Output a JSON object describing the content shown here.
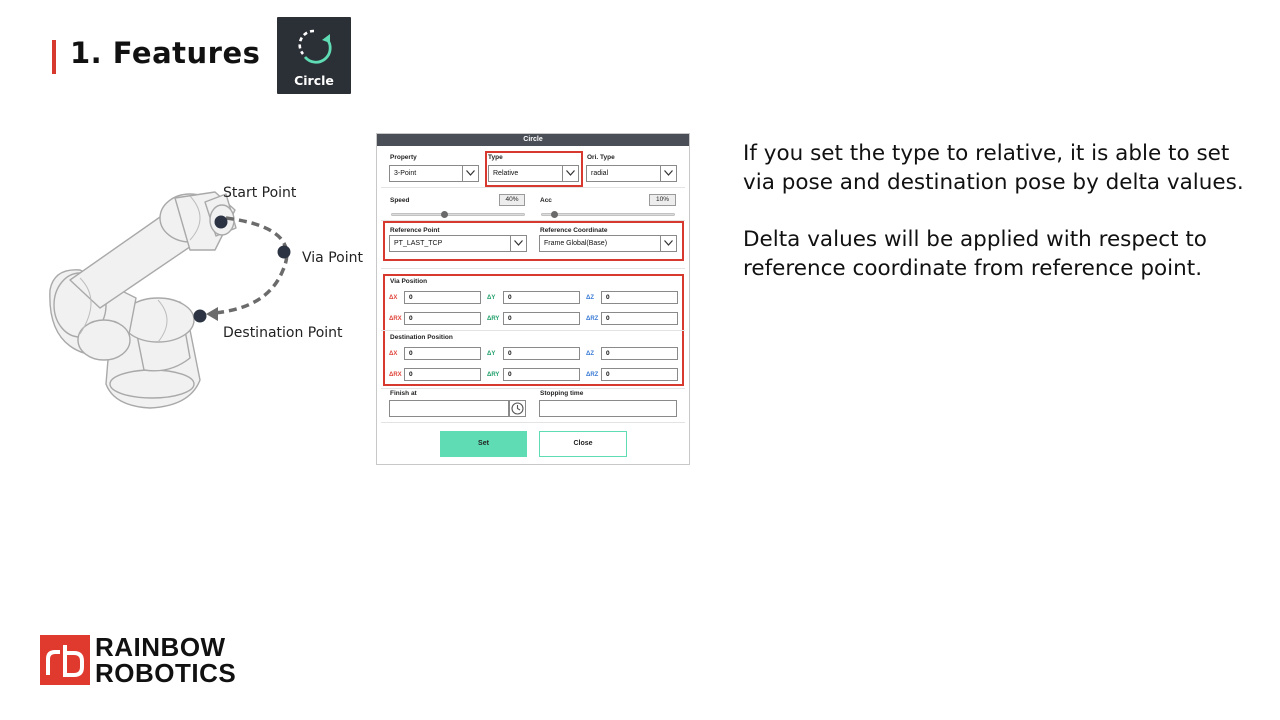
{
  "header": {
    "title": "1. Features",
    "tile_label": "Circle",
    "tile_icon": "circle-arrow-icon"
  },
  "illustration": {
    "labels": {
      "start": "Start Point",
      "via": "Via Point",
      "destination": "Destination Point"
    }
  },
  "dialog": {
    "title": "Circle",
    "property": {
      "label": "Property",
      "value": "3-Point"
    },
    "type": {
      "label": "Type",
      "value": "Relative"
    },
    "ori_type": {
      "label": "Ori. Type",
      "value": "radial"
    },
    "speed": {
      "label": "Speed",
      "value": "40%",
      "level": 0.4
    },
    "acc": {
      "label": "Acc",
      "value": "10%",
      "level": 0.1
    },
    "reference_point": {
      "label": "Reference Point",
      "value": "PT_LAST_TCP"
    },
    "reference_coordinate": {
      "label": "Reference Coordinate",
      "value": "Frame Global(Base)"
    },
    "via_position": {
      "label": "Via Position",
      "fields": [
        {
          "axis": "ΔX",
          "value": "0"
        },
        {
          "axis": "ΔY",
          "value": "0"
        },
        {
          "axis": "ΔZ",
          "value": "0"
        },
        {
          "axis": "ΔRX",
          "value": "0"
        },
        {
          "axis": "ΔRY",
          "value": "0"
        },
        {
          "axis": "ΔRZ",
          "value": "0"
        }
      ]
    },
    "destination_position": {
      "label": "Destination Position",
      "fields": [
        {
          "axis": "ΔX",
          "value": "0"
        },
        {
          "axis": "ΔY",
          "value": "0"
        },
        {
          "axis": "ΔZ",
          "value": "0"
        },
        {
          "axis": "ΔRX",
          "value": "0"
        },
        {
          "axis": "ΔRY",
          "value": "0"
        },
        {
          "axis": "ΔRZ",
          "value": "0"
        }
      ]
    },
    "finish_at": {
      "label": "Finish at",
      "value": ""
    },
    "stopping_time": {
      "label": "Stopping time",
      "value": ""
    },
    "buttons": {
      "set": "Set",
      "close": "Close"
    }
  },
  "description": {
    "paragraph1": [
      "If you set the type to relative, it is able to set",
      "via pose and destination pose by delta values."
    ],
    "paragraph2": [
      "Delta values will be applied with respect to",
      "reference coordinate from reference point."
    ]
  },
  "logo": {
    "line1": "RAINBOW",
    "line2": "ROBOTICS"
  },
  "colors": {
    "accent": "#d7392f",
    "button": "#5fdcb3",
    "tile": "#2b2f36",
    "logo": "#e03a2f"
  }
}
